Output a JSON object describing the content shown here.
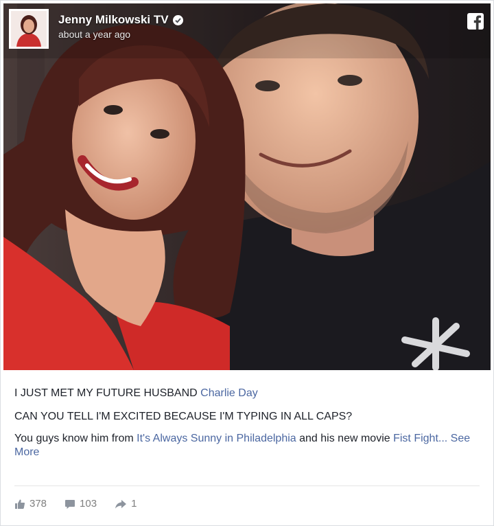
{
  "post": {
    "author": "Jenny Milkowski TV",
    "time": "about a year ago",
    "line1_text": "I JUST MET MY FUTURE HUSBAND ",
    "line1_link": "Charlie Day",
    "line2": "CAN YOU TELL I'M EXCITED BECAUSE I'M TYPING IN ALL CAPS?",
    "line3_a": "You guys know him from ",
    "line3_link1": "It's Always Sunny in Philadelphia",
    "line3_b": " and his new movie ",
    "line3_link2": "Fist Fight",
    "line3_ellipsis": "... ",
    "see_more": "See More"
  },
  "stats": {
    "likes": "378",
    "comments": "103",
    "shares": "1"
  },
  "colors": {
    "link": "#4b67a1",
    "text": "#1d2129",
    "muted": "#7f7f7f"
  },
  "icons": {
    "verified": "verified-badge-icon",
    "facebook": "facebook-logo-icon",
    "like": "thumbs-up-icon",
    "comment": "comment-bubble-icon",
    "share": "share-arrow-icon"
  }
}
